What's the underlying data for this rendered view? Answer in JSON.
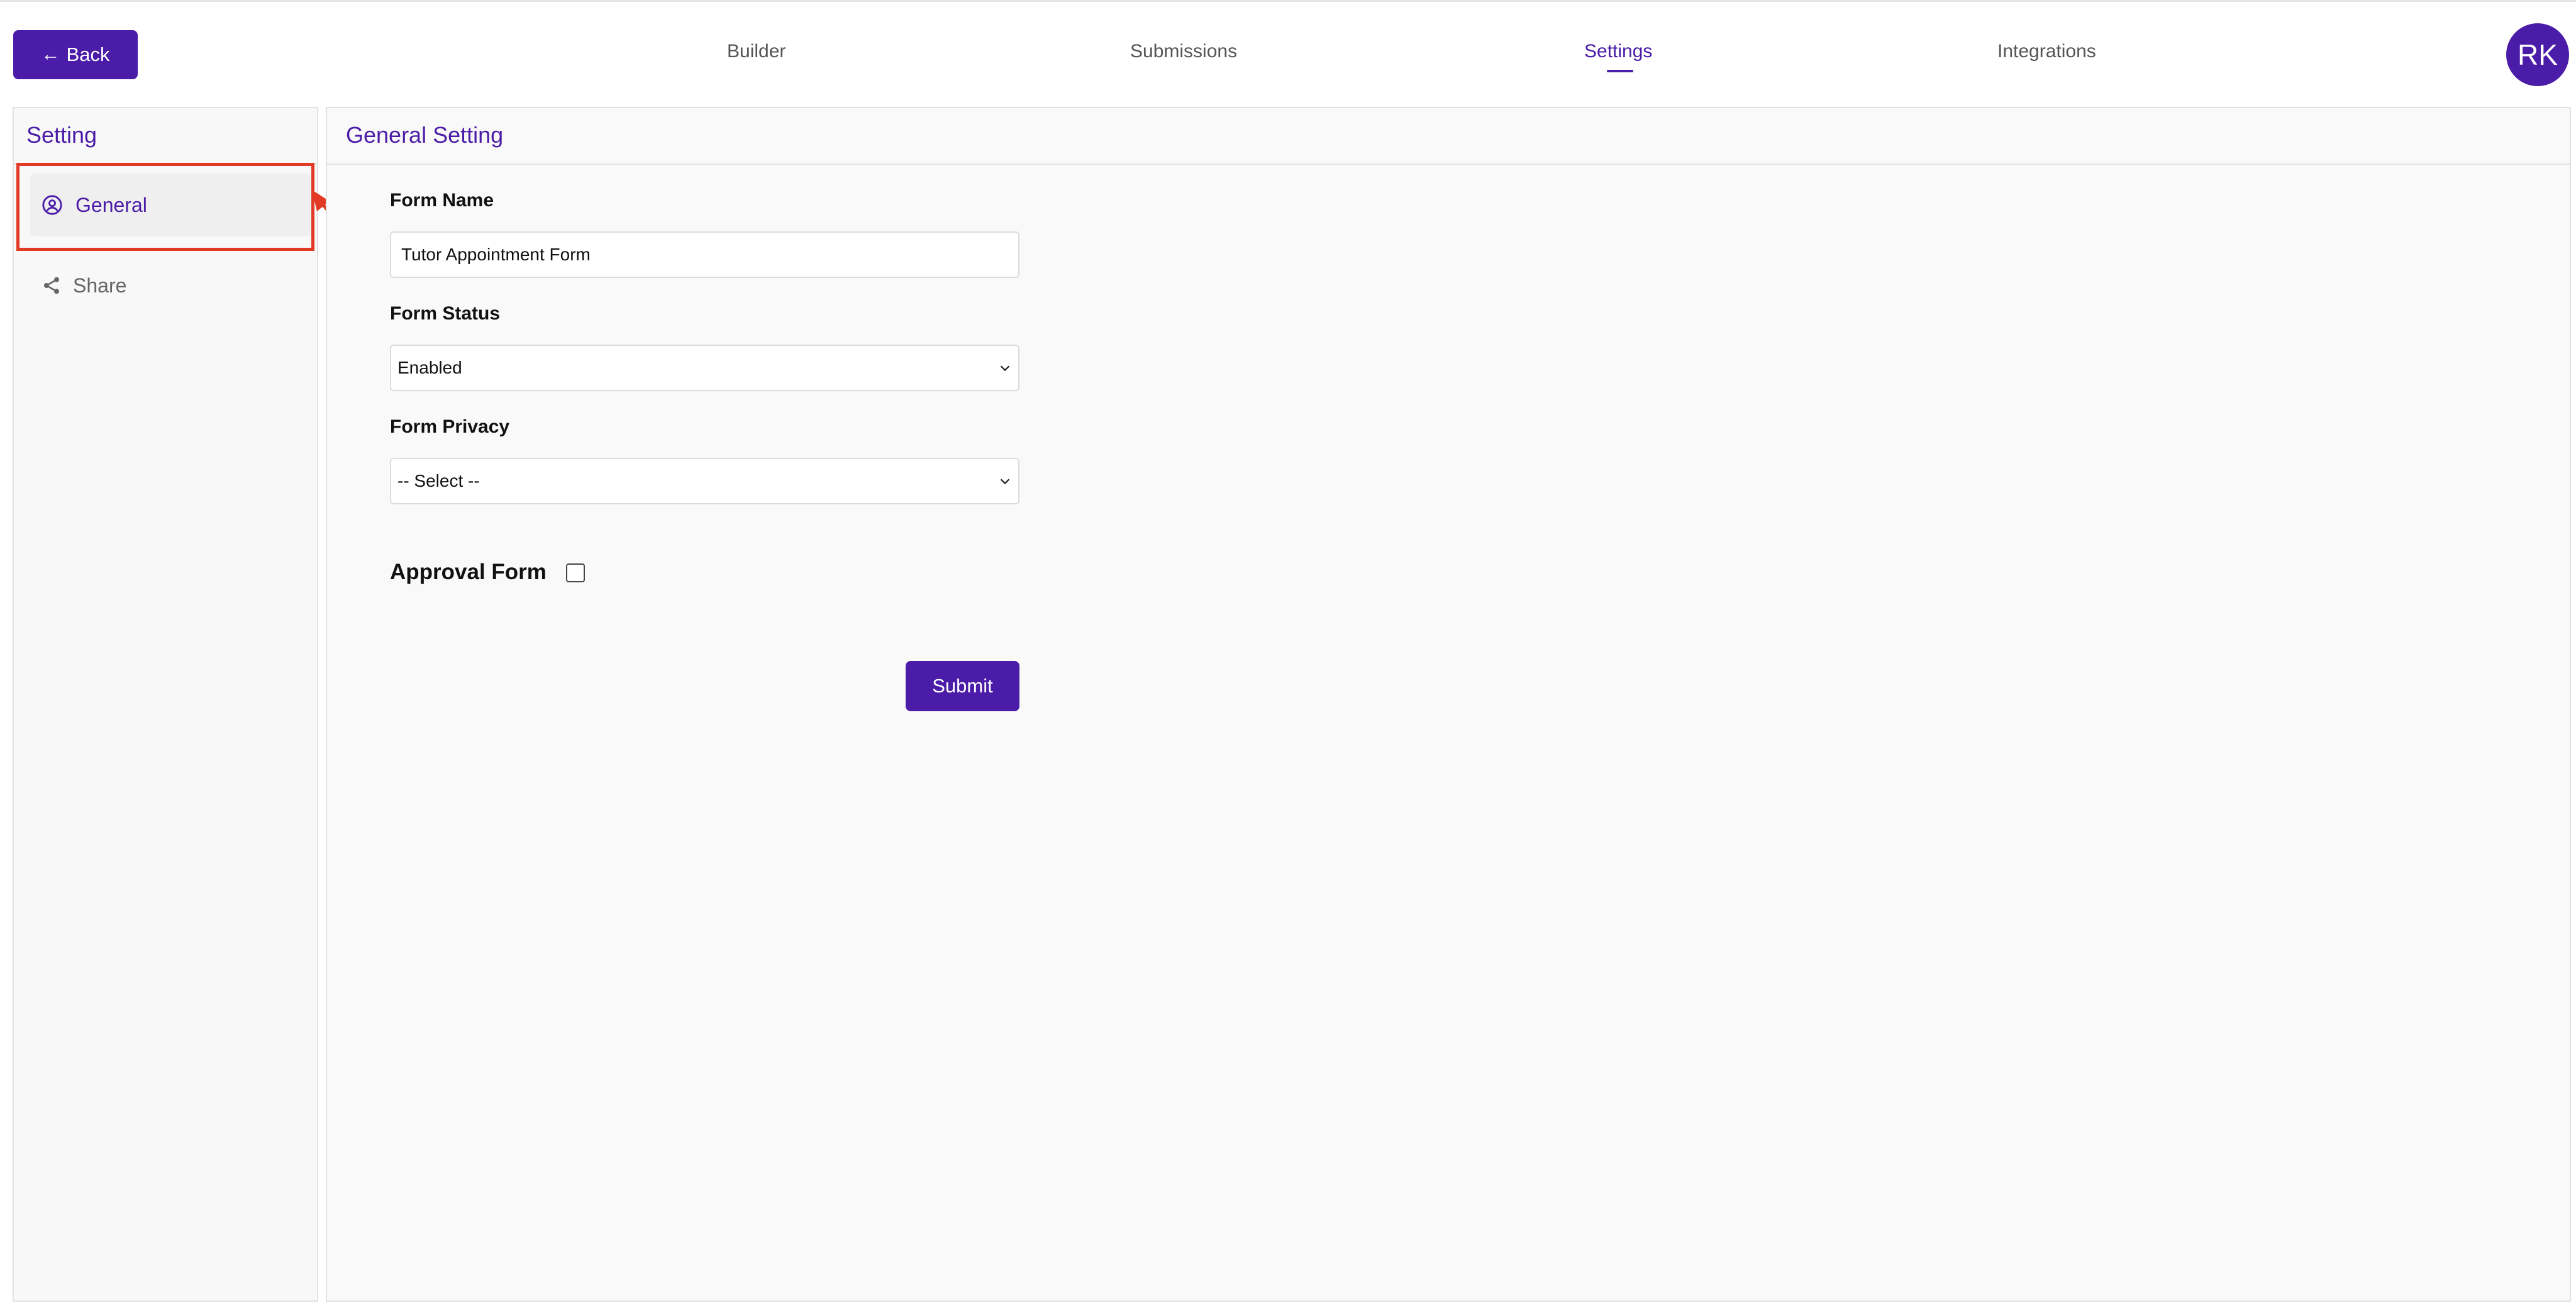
{
  "header": {
    "back_label": "Back",
    "tabs": [
      {
        "label": "Builder",
        "active": false
      },
      {
        "label": "Submissions",
        "active": false
      },
      {
        "label": "Settings",
        "active": true
      },
      {
        "label": "Integrations",
        "active": false
      }
    ],
    "avatar_initials": "RK"
  },
  "sidebar": {
    "title": "Setting",
    "items": [
      {
        "label": "General",
        "icon": "user-circle-icon",
        "active": true
      },
      {
        "label": "Share",
        "icon": "share-icon",
        "active": false
      }
    ]
  },
  "main": {
    "title": "General Setting",
    "form_name": {
      "label": "Form Name",
      "value": "Tutor Appointment Form"
    },
    "form_status": {
      "label": "Form Status",
      "value": "Enabled"
    },
    "form_privacy": {
      "label": "Form Privacy",
      "value": "-- Select --"
    },
    "approval": {
      "label": "Approval Form",
      "checked": false
    },
    "submit_label": "Submit"
  },
  "colors": {
    "accent": "#4b1ca7",
    "annotation": "#e23a24",
    "panel_bg": "#f9f9f9"
  }
}
